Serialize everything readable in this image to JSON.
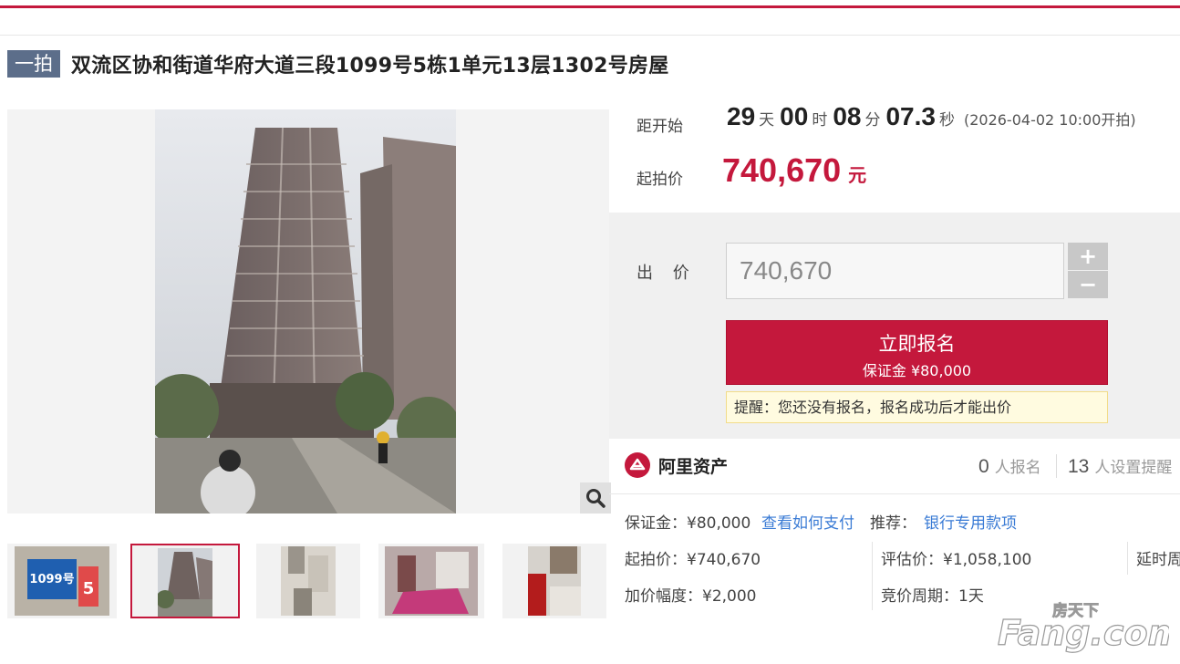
{
  "header": {
    "round_badge": "一拍",
    "title": "双流区协和街道华府大道三段1099号5栋1单元13层1302号房屋"
  },
  "gallery": {
    "thumbnails": [
      {
        "name": "thumbnail-1",
        "desc": "street-sign",
        "sign_text": "1099号",
        "sign_extra": "5"
      },
      {
        "name": "thumbnail-2",
        "desc": "building-exterior"
      },
      {
        "name": "thumbnail-3",
        "desc": "bathroom"
      },
      {
        "name": "thumbnail-4",
        "desc": "bedroom"
      },
      {
        "name": "thumbnail-5",
        "desc": "kitchen"
      }
    ],
    "active_index": 1,
    "zoom_icon": "magnifier-icon"
  },
  "countdown": {
    "label": "距开始",
    "days": "29",
    "days_unit": "天",
    "hours": "00",
    "hours_unit": "时",
    "minutes": "08",
    "minutes_unit": "分",
    "seconds": "07.3",
    "seconds_unit": "秒",
    "start_time": "(2026-04-02 10:00开拍)"
  },
  "starting_price": {
    "label": "起拍价",
    "value": "740,670",
    "unit": "元"
  },
  "bid": {
    "label": "出 价",
    "input_value": "740,670",
    "plus": "+",
    "minus": "−",
    "signup_label": "立即报名",
    "deposit_label": "保证金 ¥80,000",
    "reminder": "提醒：您还没有报名，报名成功后才能出价"
  },
  "brand": {
    "name": "阿里资产",
    "icon": "ali-asset-logo-icon"
  },
  "stats": {
    "signups_count": "0",
    "signups_label": "人报名",
    "reminders_count": "13",
    "reminders_label": "人设置提醒"
  },
  "details": {
    "deposit": "保证金：¥80,000",
    "how_to_pay": "查看如何支付",
    "recommend_label": "推荐：",
    "recommend_link": "银行专用款项",
    "start_price": "起拍价：¥740,670",
    "appraisal": "评估价：¥1,058,100",
    "delay": "延时周",
    "increment": "加价幅度：¥2,000",
    "cycle": "竞价周期：1天"
  },
  "watermark": {
    "cn": "房天下",
    "en": "Fang.com"
  },
  "colors": {
    "accent": "#c4183c",
    "badge": "#5c6e8a",
    "link": "#3a7bd5"
  }
}
